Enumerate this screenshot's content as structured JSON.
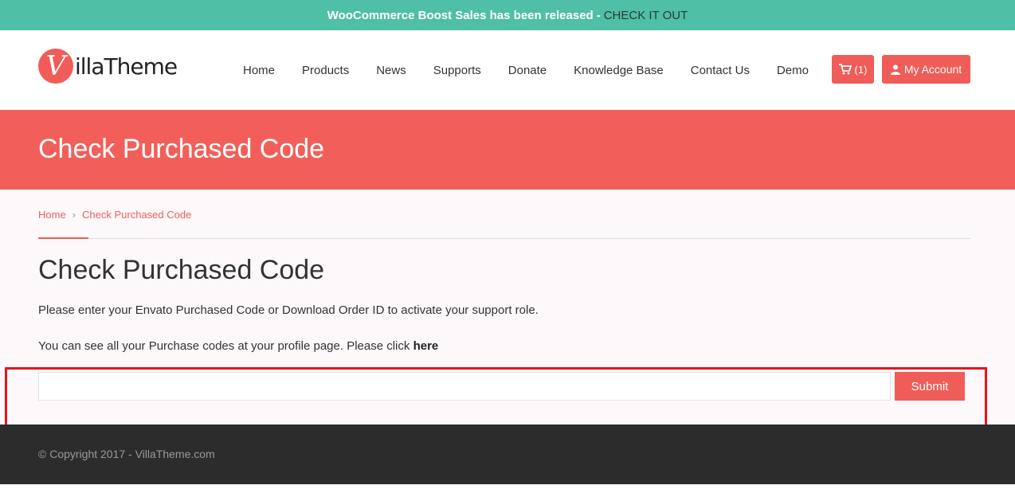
{
  "announcement": {
    "message": "WooCommerce Boost Sales has been released",
    "separator": "-",
    "cta": "CHECK IT OUT"
  },
  "brand": {
    "logo_letter": "V",
    "logo_text": "illaTheme"
  },
  "nav": {
    "items": [
      "Home",
      "Products",
      "News",
      "Supports",
      "Donate",
      "Knowledge Base",
      "Contact Us",
      "Demo"
    ],
    "cart_count": "(1)",
    "account_label": "My Account"
  },
  "hero": {
    "title": "Check Purchased Code"
  },
  "breadcrumb": {
    "home": "Home",
    "current": "Check Purchased Code"
  },
  "main": {
    "title": "Check Purchased Code",
    "instruction": "Please enter your Envato Purchased Code or Download Order ID to activate your support role.",
    "profile_text": "You can see all your Purchase codes at your profile page. Please click",
    "profile_link": "here",
    "input_value": "",
    "submit_label": "Submit"
  },
  "footer": {
    "copyright": "© Copyright 2017 - VillaTheme.com"
  },
  "colors": {
    "topbar": "#4fbfa5",
    "accent": "#f05d58",
    "hero": "#f25f5a",
    "footer": "#2c2c2c",
    "highlight_box": "#e8141b"
  }
}
